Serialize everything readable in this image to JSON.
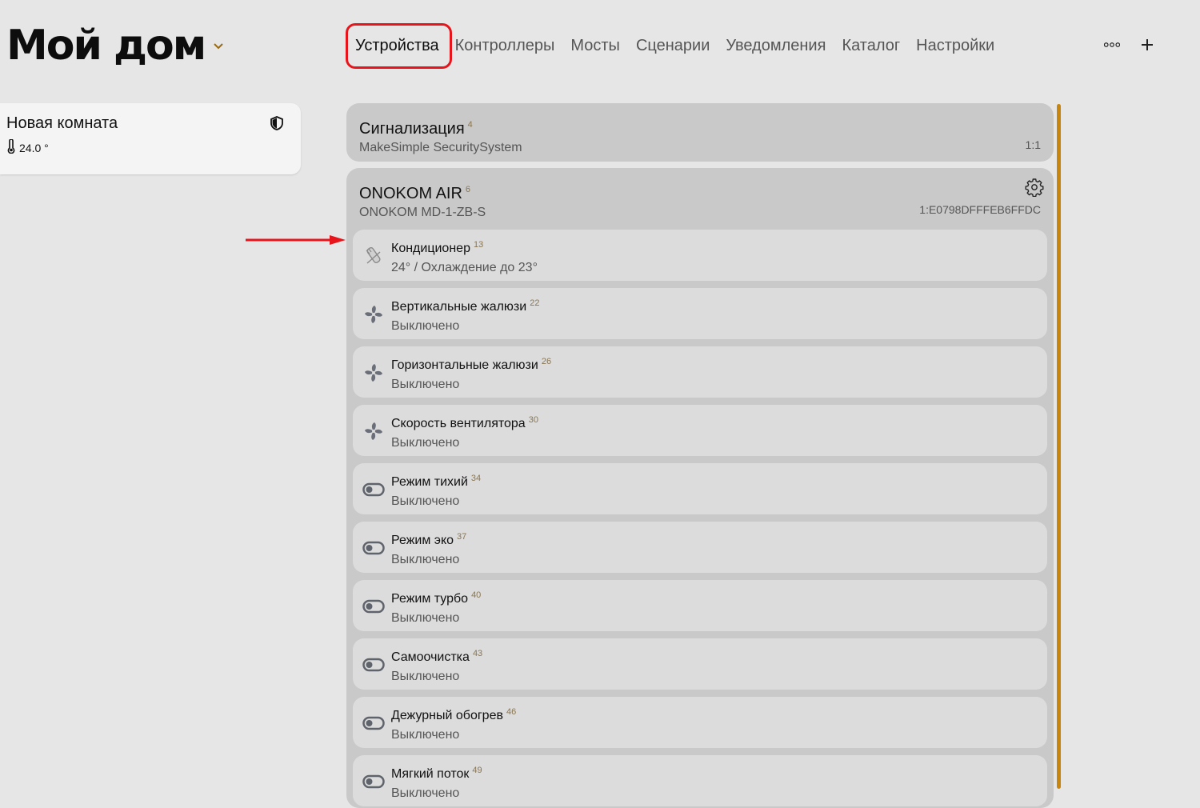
{
  "header": {
    "home_title": "Мой дом"
  },
  "nav": {
    "tabs": [
      {
        "label": "Устройства",
        "active": true
      },
      {
        "label": "Контроллеры"
      },
      {
        "label": "Мосты"
      },
      {
        "label": "Сценарии"
      },
      {
        "label": "Уведомления"
      },
      {
        "label": "Каталог"
      },
      {
        "label": "Настройки"
      }
    ]
  },
  "actions": {
    "more_icon": "more-dots-icon",
    "add_icon": "plus-icon"
  },
  "room": {
    "name": "Новая комната",
    "temperature": "24.0 °",
    "icon": "thermometer-icon",
    "badge_icon": "shield-icon"
  },
  "groups": {
    "alarm": {
      "title": "Сигнализация",
      "count": "4",
      "subtitle": "MakeSimple SecuritySystem",
      "id": "1:1"
    },
    "onokom": {
      "title": "ONOKOM AIR",
      "count": "6",
      "subtitle": "ONOKOM MD-1-ZB-S",
      "id": "1:E0798DFFFEB6FFDC"
    }
  },
  "devices": [
    {
      "title": "Кондиционер",
      "num": "13",
      "status": "24° / Охлаждение до 23°",
      "icon": "ac-remote-icon"
    },
    {
      "title": "Вертикальные жалюзи",
      "num": "22",
      "status": "Выключено",
      "icon": "fan-icon"
    },
    {
      "title": "Горизонтальные жалюзи",
      "num": "26",
      "status": "Выключено",
      "icon": "fan-icon"
    },
    {
      "title": "Скорость вентилятора",
      "num": "30",
      "status": "Выключено",
      "icon": "fan-icon"
    },
    {
      "title": "Режим тихий",
      "num": "34",
      "status": "Выключено",
      "icon": "toggle-icon"
    },
    {
      "title": "Режим эко",
      "num": "37",
      "status": "Выключено",
      "icon": "toggle-icon"
    },
    {
      "title": "Режим турбо",
      "num": "40",
      "status": "Выключено",
      "icon": "toggle-icon"
    },
    {
      "title": "Самоочистка",
      "num": "43",
      "status": "Выключено",
      "icon": "toggle-icon"
    },
    {
      "title": "Дежурный обогрев",
      "num": "46",
      "status": "Выключено",
      "icon": "toggle-icon"
    },
    {
      "title": "Мягкий поток",
      "num": "49",
      "status": "Выключено",
      "icon": "toggle-icon"
    }
  ],
  "colors": {
    "accent": "#c8860f",
    "highlight": "#e8141b",
    "annotation_arrow": "#e8141b"
  }
}
